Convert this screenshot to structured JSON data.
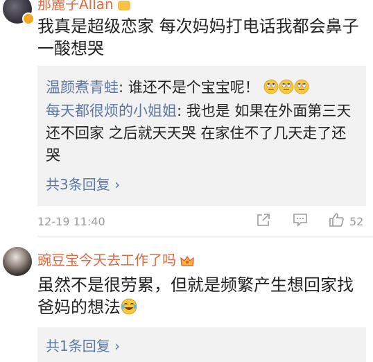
{
  "comment1": {
    "username": "那麓子Allan",
    "text": "我真是超级恋家 每次妈妈打电话我都会鼻子一酸想哭",
    "replies": [
      {
        "name": "温颜煮青蛙",
        "text": ": 谁还不是个宝宝呢！"
      },
      {
        "name": "每天都很烦的小姐姐",
        "text": ": 我也是 如果在外面第三天还不回家 之后就天天哭 在家住不了几天走了还哭"
      }
    ],
    "more_replies": "共3条回复 ›",
    "timestamp": "12-19 11:40",
    "like_count": "52"
  },
  "comment2": {
    "username": "豌豆宝今天去工作了吗",
    "text": "虽然不是很劳累，但就是频繁产生想回家找爸妈的想法",
    "more_replies": "共1条回复 ›"
  },
  "icons": {
    "rolleyes": "rolling-eyes-emoji",
    "laugh_cry": "laugh-cry-emoji",
    "share": "share-icon",
    "comment": "comment-icon",
    "like": "thumbs-up-icon"
  },
  "colors": {
    "username": "#e1693e",
    "reply_name": "#5a77a6",
    "reply_bg": "#f2f2f2",
    "meta": "#9a9a9a"
  }
}
